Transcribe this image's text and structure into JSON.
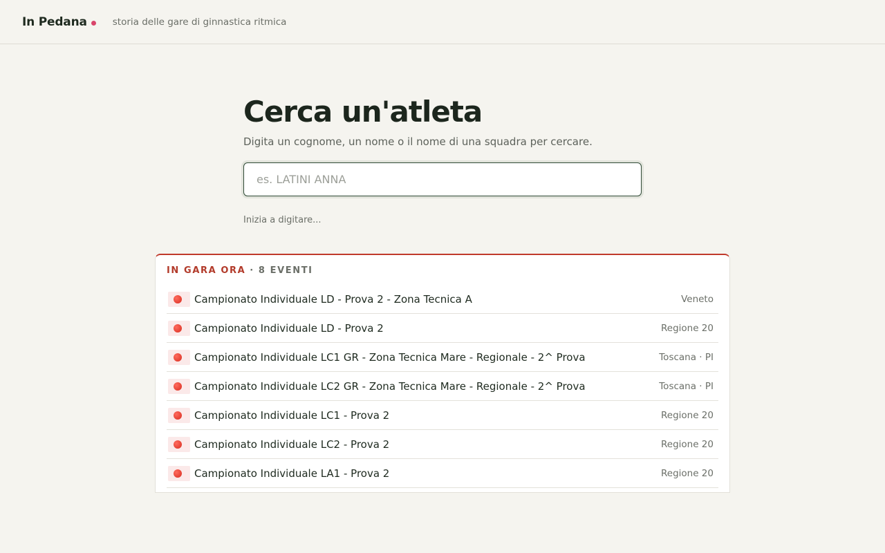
{
  "header": {
    "brand": "In Pedana",
    "tagline": "storia delle gare di ginnastica ritmica"
  },
  "search": {
    "title": "Cerca un'atleta",
    "subtitle": "Digita un cognome, un nome o il nome di una squadra per cercare.",
    "placeholder": "es. LATINI ANNA",
    "value": "",
    "hint": "Inizia a digitare..."
  },
  "live": {
    "label": "IN GARA ORA",
    "separator": "·",
    "count": "8 EVENTI",
    "events": [
      {
        "name": "Campionato Individuale LD - Prova 2 - Zona Tecnica A",
        "region": "Veneto",
        "icon": "red-circle-icon"
      },
      {
        "name": "Campionato Individuale LD - Prova 2",
        "region": "Regione 20",
        "icon": "red-circle-icon"
      },
      {
        "name": "Campionato Individuale LC1 GR - Zona Tecnica Mare - Regionale - 2^ Prova",
        "region": "Toscana · PI",
        "icon": "red-circle-icon"
      },
      {
        "name": "Campionato Individuale LC2 GR - Zona Tecnica Mare - Regionale - 2^ Prova",
        "region": "Toscana · PI",
        "icon": "red-circle-icon"
      },
      {
        "name": "Campionato Individuale LC1 - Prova 2",
        "region": "Regione 20",
        "icon": "red-circle-icon"
      },
      {
        "name": "Campionato Individuale LC2 - Prova 2",
        "region": "Regione 20",
        "icon": "red-circle-icon"
      },
      {
        "name": "Campionato Individuale LA1 - Prova 2",
        "region": "Regione 20",
        "icon": "red-circle-icon"
      }
    ]
  },
  "colors": {
    "background": "#f5f4ef",
    "accent_live": "#b23a2a",
    "brand_dot": "#d9456a",
    "input_border": "#2f4a35"
  }
}
